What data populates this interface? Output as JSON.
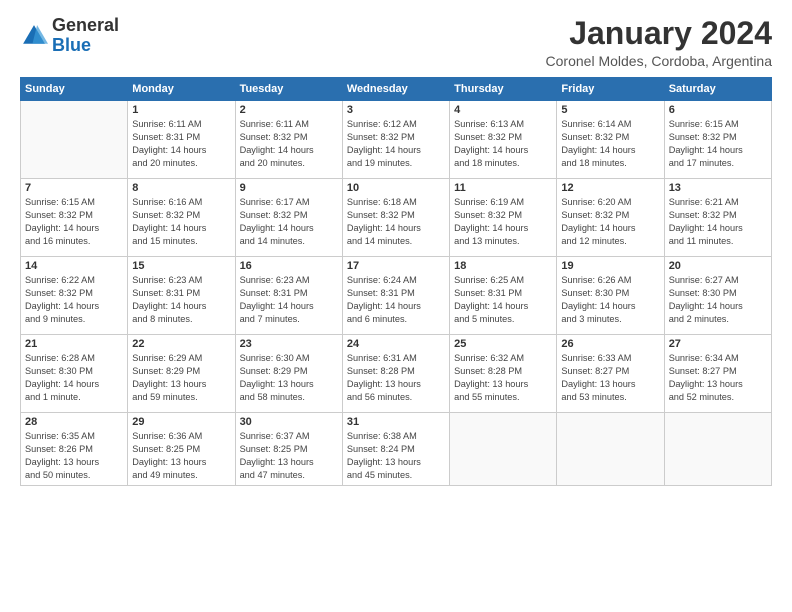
{
  "logo": {
    "general": "General",
    "blue": "Blue"
  },
  "header": {
    "title": "January 2024",
    "subtitle": "Coronel Moldes, Cordoba, Argentina"
  },
  "days": [
    "Sunday",
    "Monday",
    "Tuesday",
    "Wednesday",
    "Thursday",
    "Friday",
    "Saturday"
  ],
  "weeks": [
    [
      {
        "day": "",
        "info": ""
      },
      {
        "day": "1",
        "info": "Sunrise: 6:11 AM\nSunset: 8:31 PM\nDaylight: 14 hours\nand 20 minutes."
      },
      {
        "day": "2",
        "info": "Sunrise: 6:11 AM\nSunset: 8:32 PM\nDaylight: 14 hours\nand 20 minutes."
      },
      {
        "day": "3",
        "info": "Sunrise: 6:12 AM\nSunset: 8:32 PM\nDaylight: 14 hours\nand 19 minutes."
      },
      {
        "day": "4",
        "info": "Sunrise: 6:13 AM\nSunset: 8:32 PM\nDaylight: 14 hours\nand 18 minutes."
      },
      {
        "day": "5",
        "info": "Sunrise: 6:14 AM\nSunset: 8:32 PM\nDaylight: 14 hours\nand 18 minutes."
      },
      {
        "day": "6",
        "info": "Sunrise: 6:15 AM\nSunset: 8:32 PM\nDaylight: 14 hours\nand 17 minutes."
      }
    ],
    [
      {
        "day": "7",
        "info": "Sunrise: 6:15 AM\nSunset: 8:32 PM\nDaylight: 14 hours\nand 16 minutes."
      },
      {
        "day": "8",
        "info": "Sunrise: 6:16 AM\nSunset: 8:32 PM\nDaylight: 14 hours\nand 15 minutes."
      },
      {
        "day": "9",
        "info": "Sunrise: 6:17 AM\nSunset: 8:32 PM\nDaylight: 14 hours\nand 14 minutes."
      },
      {
        "day": "10",
        "info": "Sunrise: 6:18 AM\nSunset: 8:32 PM\nDaylight: 14 hours\nand 14 minutes."
      },
      {
        "day": "11",
        "info": "Sunrise: 6:19 AM\nSunset: 8:32 PM\nDaylight: 14 hours\nand 13 minutes."
      },
      {
        "day": "12",
        "info": "Sunrise: 6:20 AM\nSunset: 8:32 PM\nDaylight: 14 hours\nand 12 minutes."
      },
      {
        "day": "13",
        "info": "Sunrise: 6:21 AM\nSunset: 8:32 PM\nDaylight: 14 hours\nand 11 minutes."
      }
    ],
    [
      {
        "day": "14",
        "info": "Sunrise: 6:22 AM\nSunset: 8:32 PM\nDaylight: 14 hours\nand 9 minutes."
      },
      {
        "day": "15",
        "info": "Sunrise: 6:23 AM\nSunset: 8:31 PM\nDaylight: 14 hours\nand 8 minutes."
      },
      {
        "day": "16",
        "info": "Sunrise: 6:23 AM\nSunset: 8:31 PM\nDaylight: 14 hours\nand 7 minutes."
      },
      {
        "day": "17",
        "info": "Sunrise: 6:24 AM\nSunset: 8:31 PM\nDaylight: 14 hours\nand 6 minutes."
      },
      {
        "day": "18",
        "info": "Sunrise: 6:25 AM\nSunset: 8:31 PM\nDaylight: 14 hours\nand 5 minutes."
      },
      {
        "day": "19",
        "info": "Sunrise: 6:26 AM\nSunset: 8:30 PM\nDaylight: 14 hours\nand 3 minutes."
      },
      {
        "day": "20",
        "info": "Sunrise: 6:27 AM\nSunset: 8:30 PM\nDaylight: 14 hours\nand 2 minutes."
      }
    ],
    [
      {
        "day": "21",
        "info": "Sunrise: 6:28 AM\nSunset: 8:30 PM\nDaylight: 14 hours\nand 1 minute."
      },
      {
        "day": "22",
        "info": "Sunrise: 6:29 AM\nSunset: 8:29 PM\nDaylight: 13 hours\nand 59 minutes."
      },
      {
        "day": "23",
        "info": "Sunrise: 6:30 AM\nSunset: 8:29 PM\nDaylight: 13 hours\nand 58 minutes."
      },
      {
        "day": "24",
        "info": "Sunrise: 6:31 AM\nSunset: 8:28 PM\nDaylight: 13 hours\nand 56 minutes."
      },
      {
        "day": "25",
        "info": "Sunrise: 6:32 AM\nSunset: 8:28 PM\nDaylight: 13 hours\nand 55 minutes."
      },
      {
        "day": "26",
        "info": "Sunrise: 6:33 AM\nSunset: 8:27 PM\nDaylight: 13 hours\nand 53 minutes."
      },
      {
        "day": "27",
        "info": "Sunrise: 6:34 AM\nSunset: 8:27 PM\nDaylight: 13 hours\nand 52 minutes."
      }
    ],
    [
      {
        "day": "28",
        "info": "Sunrise: 6:35 AM\nSunset: 8:26 PM\nDaylight: 13 hours\nand 50 minutes."
      },
      {
        "day": "29",
        "info": "Sunrise: 6:36 AM\nSunset: 8:25 PM\nDaylight: 13 hours\nand 49 minutes."
      },
      {
        "day": "30",
        "info": "Sunrise: 6:37 AM\nSunset: 8:25 PM\nDaylight: 13 hours\nand 47 minutes."
      },
      {
        "day": "31",
        "info": "Sunrise: 6:38 AM\nSunset: 8:24 PM\nDaylight: 13 hours\nand 45 minutes."
      },
      {
        "day": "",
        "info": ""
      },
      {
        "day": "",
        "info": ""
      },
      {
        "day": "",
        "info": ""
      }
    ]
  ]
}
